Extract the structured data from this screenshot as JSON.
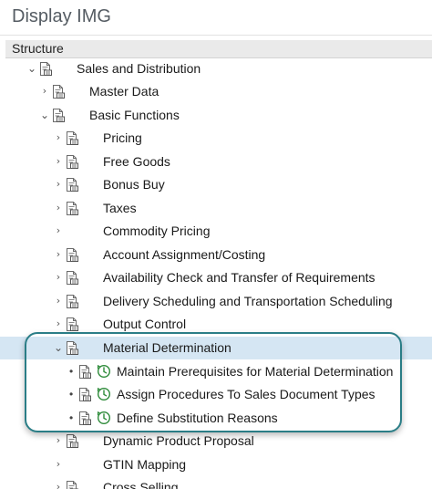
{
  "window": {
    "title": "Display IMG"
  },
  "tree": {
    "column_header": "Structure",
    "rows": [
      {
        "label": "Sales and Distribution"
      },
      {
        "label": "Master Data"
      },
      {
        "label": "Basic Functions"
      },
      {
        "label": "Pricing"
      },
      {
        "label": "Free Goods"
      },
      {
        "label": "Bonus Buy"
      },
      {
        "label": "Taxes"
      },
      {
        "label": "Commodity Pricing"
      },
      {
        "label": "Account Assignment/Costing"
      },
      {
        "label": "Availability Check and Transfer of Requirements"
      },
      {
        "label": "Delivery Scheduling and Transportation Scheduling"
      },
      {
        "label": "Output Control"
      },
      {
        "label": "Material Determination"
      },
      {
        "label": "Maintain Prerequisites for Material Determination"
      },
      {
        "label": "Assign Procedures To Sales Document Types"
      },
      {
        "label": "Define Substitution Reasons"
      },
      {
        "label": "Dynamic Product Proposal"
      },
      {
        "label": "GTIN Mapping"
      },
      {
        "label": "Cross Selling"
      }
    ]
  },
  "icons": {
    "expand": "chevron-right-icon",
    "collapse": "chevron-down-icon",
    "node": "img-document-icon",
    "activity": "execute-activity-icon",
    "leaf": "bullet-icon"
  },
  "colors": {
    "selection": "#d5e6f3",
    "highlight_border": "#2a7d86",
    "activity_icon": "#2e8b3a"
  }
}
